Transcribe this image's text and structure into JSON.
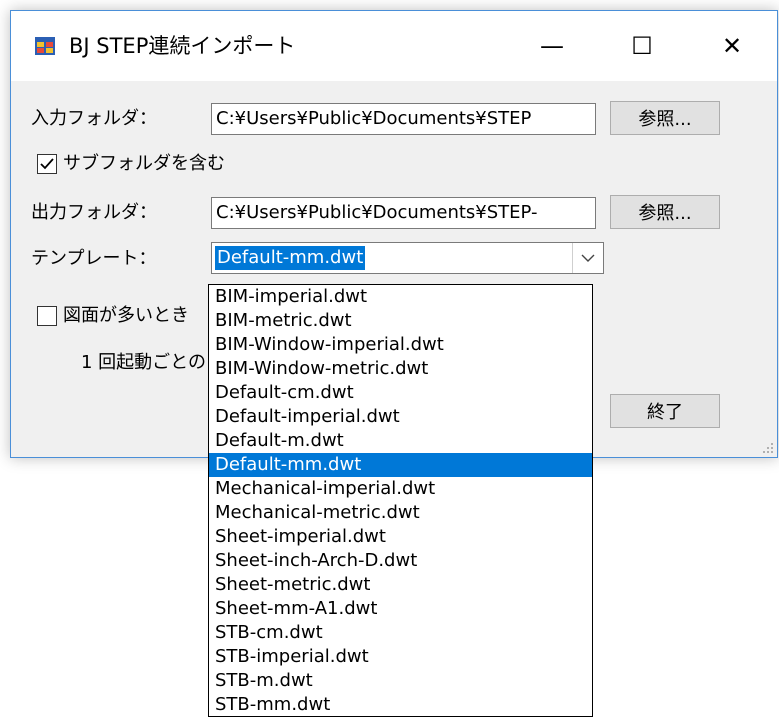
{
  "window": {
    "title": "BJ STEP連続インポート",
    "minimize_glyph": "—",
    "maximize_glyph": "☐",
    "close_glyph": "✕"
  },
  "form": {
    "input_folder_label": "入力フォルダ：",
    "input_folder_value": "C:¥Users¥Public¥Documents¥STEP",
    "browse_label": "参照...",
    "subfolder_label": "サブフォルダを含む",
    "subfolder_checked": true,
    "output_folder_label": "出力フォルダ：",
    "output_folder_value": "C:¥Users¥Public¥Documents¥STEP-",
    "template_label": "テンプレート：",
    "template_value": "Default-mm.dwt",
    "many_drawings_label": "図面が多いとき",
    "per_launch_label": "1 回起動ごとの",
    "exit_label": "終了"
  },
  "dropdown": {
    "selected_index": 7,
    "items": [
      "BIM-imperial.dwt",
      "BIM-metric.dwt",
      "BIM-Window-imperial.dwt",
      "BIM-Window-metric.dwt",
      "Default-cm.dwt",
      "Default-imperial.dwt",
      "Default-m.dwt",
      "Default-mm.dwt",
      "Mechanical-imperial.dwt",
      "Mechanical-metric.dwt",
      "Sheet-imperial.dwt",
      "Sheet-inch-Arch-D.dwt",
      "Sheet-metric.dwt",
      "Sheet-mm-A1.dwt",
      "STB-cm.dwt",
      "STB-imperial.dwt",
      "STB-m.dwt",
      "STB-mm.dwt"
    ]
  },
  "colors": {
    "selection": "#0078d7",
    "window_bg": "#f0f0f0",
    "border": "#4a8fd8"
  }
}
